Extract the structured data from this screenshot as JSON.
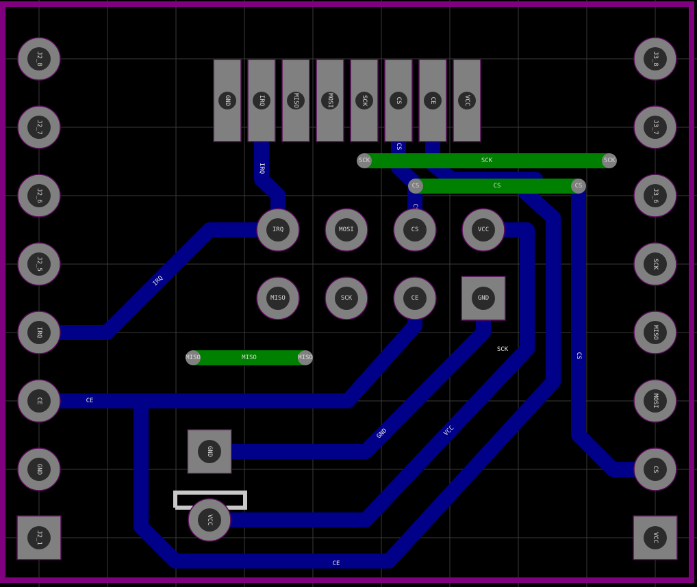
{
  "colors": {
    "background": "#000000",
    "grid": "#3a3a3a",
    "board_outline": "#800080",
    "bottom_trace": "#000088",
    "top_trace": "#008000",
    "pad": "#808080",
    "pad_edge": "#5a0a5a",
    "hole": "#2b2b2b",
    "label": "#d8d8d8",
    "silkscreen": "#c8c8c8"
  },
  "header_pins": [
    "GND",
    "IRQ",
    "MISO",
    "MOSI",
    "SCK",
    "CS",
    "CE",
    "VCC"
  ],
  "module_pads": {
    "irq": "IRQ",
    "mosi": "MOSI",
    "cs": "CS",
    "vcc": "VCC",
    "miso": "MISO",
    "sck": "SCK",
    "ce": "CE",
    "gnd": "GND"
  },
  "cap_pads": {
    "gnd": "GND",
    "vcc": "VCC"
  },
  "j2_pins": [
    "J2_8",
    "J2_7",
    "J2_6",
    "J2_5",
    "IRQ",
    "CE",
    "GND",
    "J2_1"
  ],
  "j3_pins": [
    "J3_8",
    "J3_7",
    "J3_6",
    "SCK",
    "MISO",
    "MOSI",
    "CS",
    "VCC"
  ],
  "jumpers": {
    "sck": {
      "left": "SCK",
      "mid": "SCK",
      "right": "SCK"
    },
    "cs": {
      "left": "CS",
      "mid": "CS",
      "right": "CS"
    },
    "miso": {
      "left": "MISO",
      "mid": "MISO",
      "right": "MISO"
    }
  },
  "trace_labels": {
    "irq_header": "IRQ",
    "cs_header": "CS",
    "cs_vertical": "CS",
    "irq_diag": "IRQ",
    "sck_right": "SCK",
    "cs_right": "CS",
    "ce_left": "CE",
    "gnd_diag": "GND",
    "vcc_diag": "VCC",
    "ce_bottom": "CE"
  }
}
